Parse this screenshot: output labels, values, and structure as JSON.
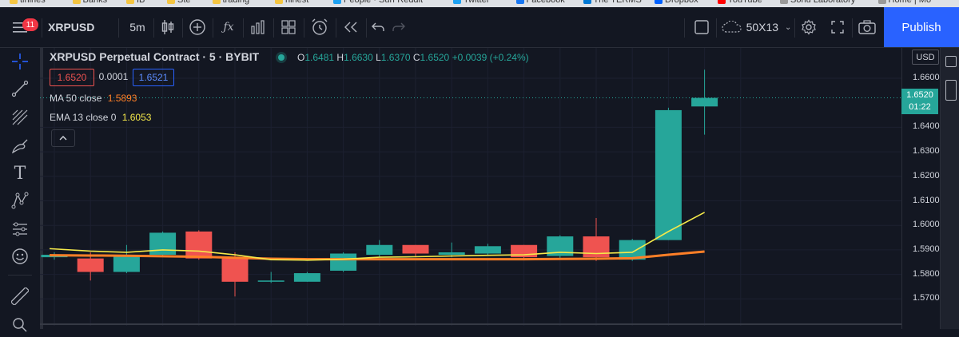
{
  "bookmarks": [
    "tinines",
    "Banks",
    "IB",
    "Ste",
    "trading",
    "hinest",
    "People · Surf Reddit",
    "Twitter",
    "Facebook",
    "The TERMS",
    "Dropbox",
    "YouTube",
    "Sonu Laboratory",
    "Home | Mo"
  ],
  "toolbar": {
    "menu_badge": "11",
    "symbol": "XRPUSD",
    "interval": "5m",
    "layout_label": "50X13",
    "publish_label": "Publish"
  },
  "legend": {
    "title": "XRPUSD Perpetual Contract · 5 · BYBIT",
    "ohlc": {
      "o_label": "O",
      "o": "1.6481",
      "h_label": "H",
      "h": "1.6630",
      "l_label": "L",
      "l": "1.6370",
      "c_label": "C",
      "c": "1.6520",
      "change": "+0.0039 (+0.24%)"
    },
    "bid": "1.6520",
    "spread": "0.0001",
    "ask": "1.6521"
  },
  "indicators": [
    {
      "label": "MA 50 close",
      "value": "1.5893",
      "color": "#ff7f27"
    },
    {
      "label": "EMA 13 close 0",
      "value": "1.6053",
      "color": "#f5e94a"
    }
  ],
  "price_axis": {
    "currency": "USD",
    "ticks": [
      "1.6600",
      "1.6400",
      "1.6300",
      "1.6200",
      "1.6100",
      "1.6000",
      "1.5900",
      "1.5800",
      "1.5700"
    ],
    "current_price": "1.6520",
    "countdown": "01:22"
  },
  "chart_data": {
    "type": "candlestick",
    "ylim": [
      1.565,
      1.67
    ],
    "up_color": "#26a69a",
    "down_color": "#ef5350",
    "candles": [
      {
        "o": 1.587,
        "h": 1.589,
        "l": 1.586,
        "c": 1.588
      },
      {
        "o": 1.5865,
        "h": 1.589,
        "l": 1.5775,
        "c": 1.581
      },
      {
        "o": 1.581,
        "h": 1.592,
        "l": 1.5805,
        "c": 1.588
      },
      {
        "o": 1.588,
        "h": 1.5975,
        "l": 1.587,
        "c": 1.597
      },
      {
        "o": 1.5975,
        "h": 1.598,
        "l": 1.586,
        "c": 1.5865
      },
      {
        "o": 1.5865,
        "h": 1.589,
        "l": 1.571,
        "c": 1.577
      },
      {
        "o": 1.577,
        "h": 1.581,
        "l": 1.5765,
        "c": 1.5775
      },
      {
        "o": 1.577,
        "h": 1.581,
        "l": 1.577,
        "c": 1.5805
      },
      {
        "o": 1.5815,
        "h": 1.589,
        "l": 1.581,
        "c": 1.5885
      },
      {
        "o": 1.588,
        "h": 1.594,
        "l": 1.587,
        "c": 1.592
      },
      {
        "o": 1.592,
        "h": 1.592,
        "l": 1.587,
        "c": 1.5885
      },
      {
        "o": 1.588,
        "h": 1.593,
        "l": 1.587,
        "c": 1.589
      },
      {
        "o": 1.5885,
        "h": 1.5925,
        "l": 1.588,
        "c": 1.5915
      },
      {
        "o": 1.592,
        "h": 1.592,
        "l": 1.586,
        "c": 1.587
      },
      {
        "o": 1.5875,
        "h": 1.596,
        "l": 1.5865,
        "c": 1.5955
      },
      {
        "o": 1.5955,
        "h": 1.603,
        "l": 1.5855,
        "c": 1.587
      },
      {
        "o": 1.586,
        "h": 1.5945,
        "l": 1.5855,
        "c": 1.594
      },
      {
        "o": 1.594,
        "h": 1.648,
        "l": 1.594,
        "c": 1.647
      },
      {
        "o": 1.6485,
        "h": 1.6635,
        "l": 1.637,
        "c": 1.652
      }
    ],
    "series": [
      {
        "name": "MA 50 close",
        "values": [
          1.5878,
          1.5877,
          1.5876,
          1.5874,
          1.5872,
          1.5868,
          1.5864,
          1.5862,
          1.5862,
          1.5862,
          1.5862,
          1.5862,
          1.5862,
          1.5862,
          1.5863,
          1.5864,
          1.5866,
          1.588,
          1.5893
        ]
      },
      {
        "name": "EMA 13 close 0",
        "values": [
          1.5905,
          1.5895,
          1.589,
          1.59,
          1.5895,
          1.588,
          1.586,
          1.5858,
          1.5862,
          1.587,
          1.5872,
          1.5875,
          1.5878,
          1.588,
          1.589,
          1.5885,
          1.589,
          1.5975,
          1.6053
        ]
      }
    ]
  }
}
